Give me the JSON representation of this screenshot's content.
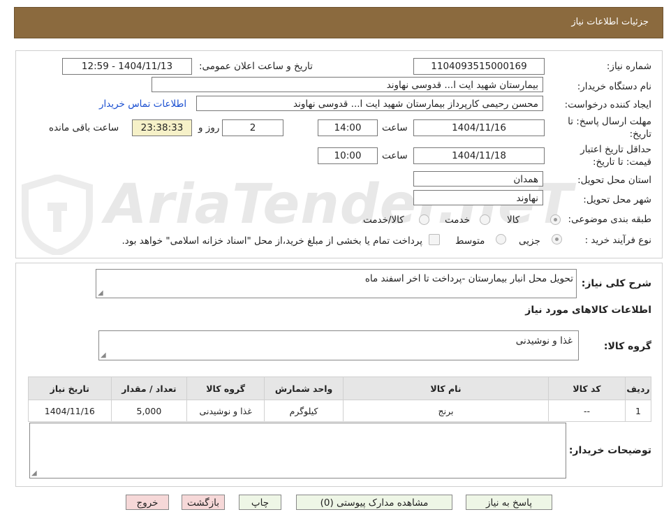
{
  "header": {
    "title": "جزئیات اطلاعات نیاز"
  },
  "watermark": {
    "text": "AriaTender.neT"
  },
  "form": {
    "need_number": {
      "label": "شماره نیاز:",
      "value": "1104093515000169"
    },
    "announce": {
      "label": "تاریخ و ساعت اعلان عمومی:",
      "value": "1404/11/13 - 12:59"
    },
    "buyer_org": {
      "label": "نام دستگاه خریدار:",
      "value": "بیمارستان شهید ایت ا... قدوسی نهاوند"
    },
    "creator": {
      "label": "ایجاد کننده درخواست:",
      "value": "محسن رحیمی کارپرداز بیمارستان شهید ایت ا... قدوسی نهاوند",
      "contact_link": "اطلاعات تماس خریدار"
    },
    "reply_deadline": {
      "label_line1": "مهلت ارسال پاسخ: تا",
      "label_line2": "تاریخ:",
      "date": "1404/11/16",
      "time_label": "ساعت",
      "time": "14:00",
      "days": "2",
      "days_label": "روز و",
      "remaining": "23:38:33",
      "remaining_label": "ساعت باقی مانده"
    },
    "price_validity": {
      "label_line1": "حداقل تاریخ اعتبار",
      "label_line2": "قیمت: تا تاریخ:",
      "date": "1404/11/18",
      "time_label": "ساعت",
      "time": "10:00"
    },
    "province": {
      "label": "استان محل تحویل:",
      "value": "همدان"
    },
    "city": {
      "label": "شهر محل تحویل:",
      "value": "نهاوند"
    },
    "category": {
      "label": "طبقه بندی موضوعی:",
      "options": [
        "کالا",
        "خدمت",
        "کالا/خدمت"
      ],
      "selected": "کالا"
    },
    "process": {
      "label": "نوع فرآیند خرید :",
      "options": [
        "جزیی",
        "متوسط"
      ],
      "selected": "جزیی",
      "note": "پرداخت تمام یا بخشی از مبلغ خرید،از محل \"اسناد خزانه اسلامی\" خواهد بود."
    }
  },
  "description": {
    "label": "شرح کلی نیاز:",
    "value": "تحویل محل انبار بیمارستان -پرداخت تا اخر اسفند ماه"
  },
  "goods_section": {
    "title": "اطلاعات کالاهای مورد نیاز",
    "group_label": "گروه کالا:",
    "group_value": "غذا و نوشیدنی",
    "table": {
      "headers": [
        "ردیف",
        "کد کالا",
        "نام کالا",
        "واحد شمارش",
        "گروه کالا",
        "تعداد / مقدار",
        "تاریخ نیاز"
      ],
      "rows": [
        [
          "1",
          "--",
          "برنج",
          "کیلوگرم",
          "غذا و نوشیدنی",
          "5,000",
          "1404/11/16"
        ]
      ]
    }
  },
  "buyer_notes": {
    "label": "توضیحات خریدار:",
    "value": ""
  },
  "buttons": {
    "reply": "پاسخ به نیاز",
    "attachments": "مشاهده مدارک پیوستی (0)",
    "print": "چاپ",
    "back": "بازگشت",
    "exit": "خروج"
  }
}
